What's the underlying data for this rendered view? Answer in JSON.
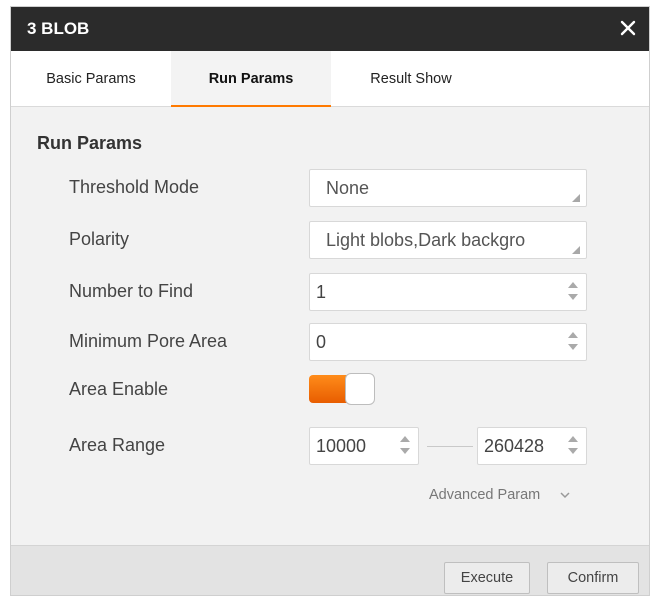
{
  "dialog": {
    "title": "3 BLOB"
  },
  "tabs": [
    {
      "label": "Basic Params"
    },
    {
      "label": "Run Params"
    },
    {
      "label": "Result Show"
    }
  ],
  "section_title": "Run Params",
  "fields": {
    "threshold_mode": {
      "label": "Threshold Mode",
      "value": "None"
    },
    "polarity": {
      "label": "Polarity",
      "value": "Light blobs,Dark backgro"
    },
    "number_to_find": {
      "label": "Number to Find",
      "value": "1"
    },
    "min_pore_area": {
      "label": "Minimum Pore Area",
      "value": "0"
    },
    "area_enable": {
      "label": "Area Enable",
      "on": true
    },
    "area_range": {
      "label": "Area Range",
      "min": "10000",
      "max": "260428"
    }
  },
  "advanced": {
    "label": "Advanced Param"
  },
  "buttons": {
    "execute": "Execute",
    "confirm": "Confirm"
  },
  "colors": {
    "accent": "#ff7a00",
    "titlebar": "#2b2b2b",
    "panel": "#f2f2f2"
  }
}
